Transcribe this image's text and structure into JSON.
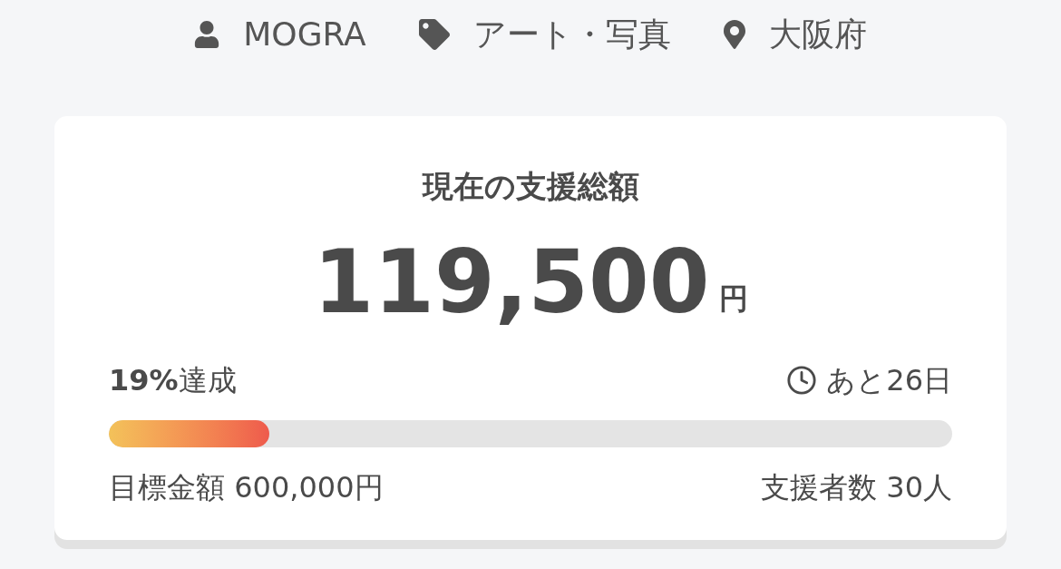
{
  "meta": [
    {
      "kind": "user",
      "text": "MOGRA"
    },
    {
      "kind": "tag",
      "text": "アート・写真"
    },
    {
      "kind": "location",
      "text": "大阪府"
    }
  ],
  "funding": {
    "title": "現在の支援総額",
    "amount": "119,500",
    "unit": "円",
    "achievement": "**19%**達成",
    "remaining": "あと26日",
    "progress": {
      "level": 0.19
    },
    "goal": "目標金額 600,000円",
    "backers": "支援者数 30人"
  }
}
